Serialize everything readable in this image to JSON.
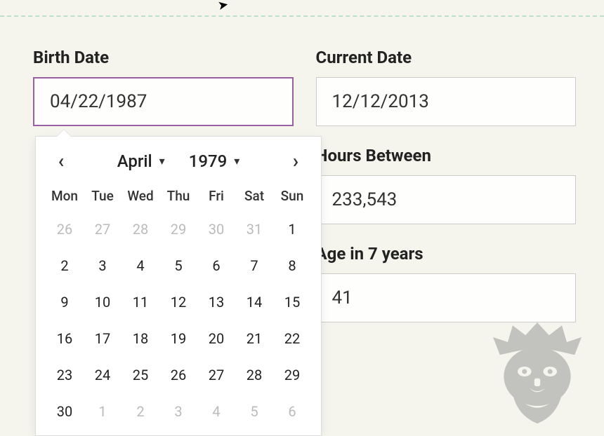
{
  "fields": {
    "birth_date": {
      "label": "Birth Date",
      "value": "04/22/1987"
    },
    "current_date": {
      "label": "Current Date",
      "value": "12/12/2013"
    },
    "hours_between": {
      "label": "Hours Between",
      "value": "233,543"
    },
    "age_in_7": {
      "label": "Age in 7 years",
      "value": "41"
    }
  },
  "datepicker": {
    "month": "April",
    "year": "1979",
    "dow": [
      "Mon",
      "Tue",
      "Wed",
      "Thu",
      "Fri",
      "Sat",
      "Sun"
    ],
    "days": [
      {
        "n": "26",
        "muted": true
      },
      {
        "n": "27",
        "muted": true
      },
      {
        "n": "28",
        "muted": true
      },
      {
        "n": "29",
        "muted": true
      },
      {
        "n": "30",
        "muted": true
      },
      {
        "n": "31",
        "muted": true
      },
      {
        "n": "1",
        "muted": false
      },
      {
        "n": "2",
        "muted": false
      },
      {
        "n": "3",
        "muted": false
      },
      {
        "n": "4",
        "muted": false
      },
      {
        "n": "5",
        "muted": false
      },
      {
        "n": "6",
        "muted": false
      },
      {
        "n": "7",
        "muted": false
      },
      {
        "n": "8",
        "muted": false
      },
      {
        "n": "9",
        "muted": false
      },
      {
        "n": "10",
        "muted": false
      },
      {
        "n": "11",
        "muted": false
      },
      {
        "n": "12",
        "muted": false
      },
      {
        "n": "13",
        "muted": false
      },
      {
        "n": "14",
        "muted": false
      },
      {
        "n": "15",
        "muted": false
      },
      {
        "n": "16",
        "muted": false
      },
      {
        "n": "17",
        "muted": false
      },
      {
        "n": "18",
        "muted": false
      },
      {
        "n": "19",
        "muted": false
      },
      {
        "n": "20",
        "muted": false
      },
      {
        "n": "21",
        "muted": false
      },
      {
        "n": "22",
        "muted": false
      },
      {
        "n": "23",
        "muted": false
      },
      {
        "n": "24",
        "muted": false
      },
      {
        "n": "25",
        "muted": false
      },
      {
        "n": "26",
        "muted": false
      },
      {
        "n": "27",
        "muted": false
      },
      {
        "n": "28",
        "muted": false
      },
      {
        "n": "29",
        "muted": false
      },
      {
        "n": "30",
        "muted": false
      },
      {
        "n": "1",
        "muted": true
      },
      {
        "n": "2",
        "muted": true
      },
      {
        "n": "3",
        "muted": true
      },
      {
        "n": "4",
        "muted": true
      },
      {
        "n": "5",
        "muted": true
      },
      {
        "n": "6",
        "muted": true
      }
    ]
  }
}
